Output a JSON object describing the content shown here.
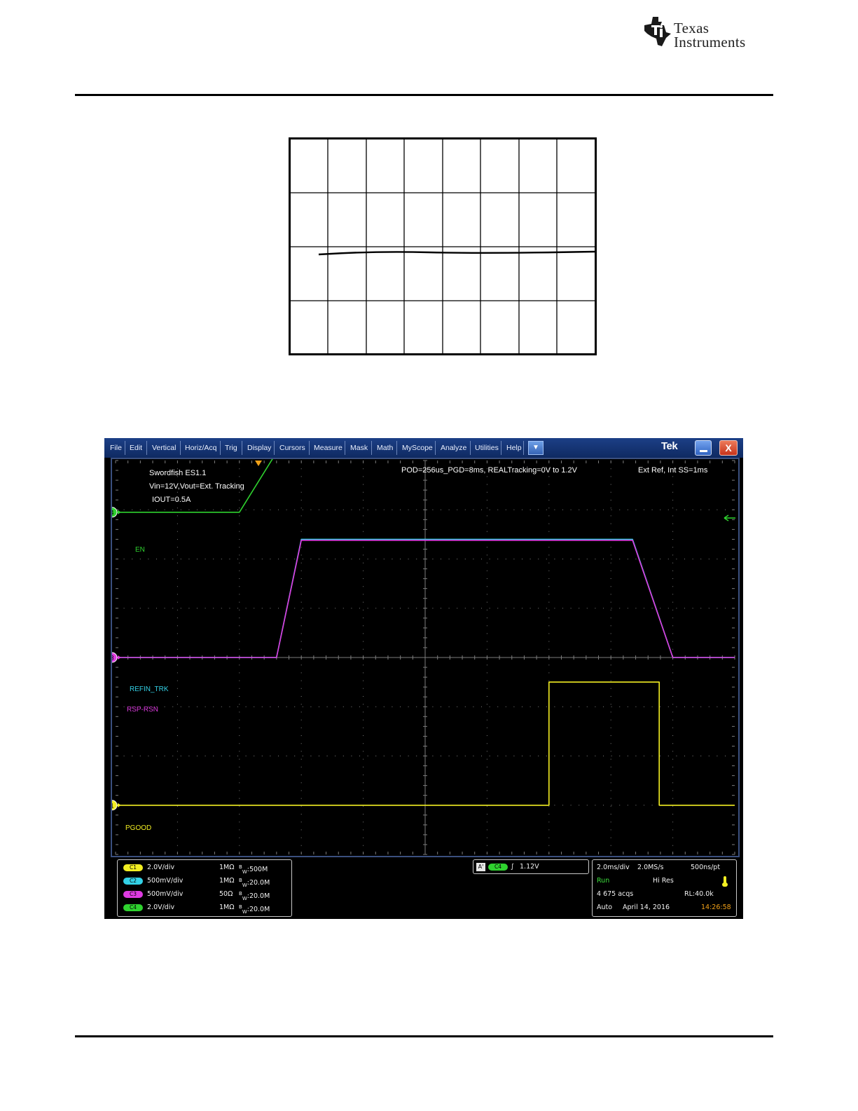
{
  "header": {
    "brand_line1": "Texas",
    "brand_line2": "Instruments"
  },
  "menu": {
    "items": [
      "File",
      "Edit",
      "Vertical",
      "Horiz/Acq",
      "Trig",
      "Display",
      "Cursors",
      "Measure",
      "Mask",
      "Math",
      "MyScope",
      "Analyze",
      "Utilities",
      "Help"
    ],
    "brand": "Tek",
    "close_glyph": "X",
    "dropdown_glyph": "▼"
  },
  "scope": {
    "annotations": {
      "title": "Swordfish ES1.1",
      "line2": "Vin=12V,Vout=Ext. Tracking",
      "line3": "IOUT=0.5A",
      "top_center": "POD=256us_PGD=8ms, REALTracking=0V to 1.2V",
      "top_right": "Ext Ref, Int SS=1ms"
    },
    "channels": [
      {
        "id": "C1",
        "marker": "1",
        "label": "PGOOD",
        "scale": "2.0V/div",
        "coupling": "1MΩ",
        "bw": "500M",
        "color": "#f2ee22"
      },
      {
        "id": "C2",
        "marker": "2",
        "label": "REFIN_TRK",
        "scale": "500mV/div",
        "coupling": "1MΩ",
        "bw": "20.0M",
        "color": "#33d1e6"
      },
      {
        "id": "C3",
        "marker": "3",
        "label": "RSP-RSN",
        "scale": "500mV/div",
        "coupling": "50Ω",
        "bw": "20.0M",
        "color": "#dd3be0"
      },
      {
        "id": "C4",
        "marker": "4",
        "label": "EN",
        "scale": "2.0V/div",
        "coupling": "1MΩ",
        "bw": "20.0M",
        "color": "#2fd22f"
      }
    ],
    "bw_prefix": "B",
    "bw_sub": "W",
    "trigger": {
      "a_label": "A'",
      "channel": "C4",
      "slope": "∫",
      "level": "1.12V"
    },
    "acquisition": {
      "timebase": "2.0ms/div",
      "sample_rate": "2.0MS/s",
      "resolution": "500ns/pt",
      "state": "Run",
      "mode": "Hi Res",
      "acqs": "4 675 acqs",
      "record_length": "RL:40.0k",
      "trigger_mode": "Auto",
      "date": "April 14, 2016",
      "time": "14:26:58"
    },
    "colors": {
      "grid": "#7d7d7d",
      "trigger_marker": "#f0a018",
      "run": "#3de03d",
      "time": "#f0a018"
    }
  },
  "chart_data": {
    "type": "line",
    "xlabel": "",
    "ylabel": "",
    "x_divisions": 10,
    "y_divisions": 8,
    "xlim": [
      0,
      10
    ],
    "ylim": [
      0,
      8
    ],
    "grid": true,
    "series": [
      {
        "name": "EN",
        "color": "#2fd22f",
        "x": [
          0,
          2.0,
          2.74,
          10
        ],
        "y": [
          6.95,
          6.95,
          8.45,
          8.45
        ]
      },
      {
        "name": "REFIN_TRK",
        "color": "#33d1e6",
        "x": [
          0,
          2.6,
          3.0,
          8.35,
          9.0,
          10
        ],
        "y": [
          4.0,
          4.0,
          6.4,
          6.4,
          4.0,
          4.0
        ]
      },
      {
        "name": "RSP-RSN",
        "color": "#dd3be0",
        "x": [
          0,
          2.6,
          3.0,
          8.35,
          9.0,
          10
        ],
        "y": [
          4.0,
          4.0,
          6.38,
          6.38,
          4.0,
          4.0
        ]
      },
      {
        "name": "PGOOD",
        "color": "#f2ee22",
        "x": [
          0,
          7.0,
          7.0,
          8.78,
          8.78,
          10
        ],
        "y": [
          1.0,
          1.0,
          3.5,
          3.5,
          1.0,
          1.0
        ]
      }
    ]
  }
}
